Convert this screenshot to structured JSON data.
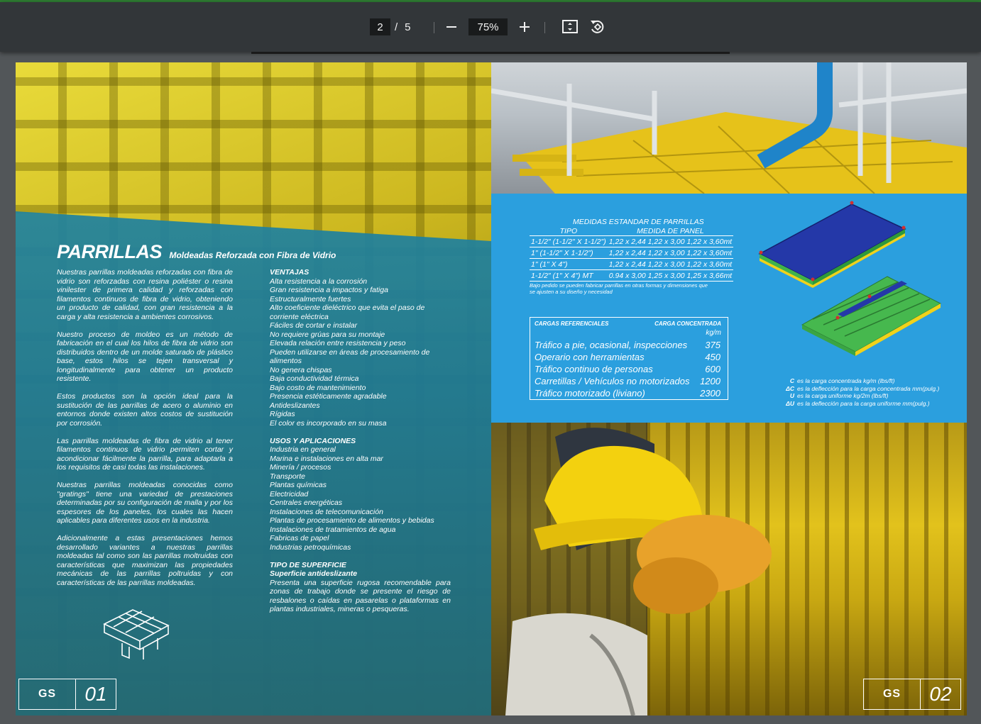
{
  "viewer": {
    "current_page": "2",
    "page_separator": "/",
    "total_pages": "5",
    "zoom": "75%",
    "zoom_out_icon": "minus-icon",
    "zoom_in_icon": "plus-icon",
    "fit_icon": "fit-page-icon",
    "rotate_icon": "rotate-icon"
  },
  "left_page": {
    "title": "PARRILLAS",
    "subtitle": "Moldeadas Reforzada con Fibra de Vidrio",
    "paragraphs": [
      "Nuestras parrillas moldeadas reforzadas con fibra de vidrio son reforzadas con resina poliéster o resina vinilester de primera calidad y reforzadas con filamentos continuos de fibra de vidrio, obteniendo un producto de calidad, con gran resistencia a la carga y alta resistencia a ambientes corrosivos.",
      "Nuestro proceso de moldeo es un método de fabricación en el cual los hilos de fibra de vidrio son distribuidos dentro de un molde saturado de plástico base, estos hilos se tejen transversal y longitudinalmente para obtener un producto resistente.",
      "Estos productos son la opción ideal para la sustitución de las parrillas de acero o aluminio en entornos donde existen altos costos de sustitución por corrosión.",
      "Las parrillas moldeadas de fibra de vidrio al tener filamentos continuos de vidrio permiten cortar y acondicionar fácilmente la parrilla, para adaptarla a los requisitos de casi todas las instalaciones.",
      "Nuestras parrillas moldeadas conocidas como \"gratings\" tiene una variedad de prestaciones determinadas por su configuración de malla y por los espesores de los paneles, los cuales las hacen aplicables para diferentes usos en la industria.",
      "Adicionalmente a estas presentaciones hemos desarrollado variantes a nuestras parrillas moldeadas tal como son las parrillas moltruidas con características que maximizan las propiedades mecánicas de las parrillas poltruidas y con características de las parrillas moldeadas."
    ],
    "ventajas_title": "VENTAJAS",
    "ventajas": [
      "Alta resistencia a la corrosión",
      "Gran resistencia a impactos y fatiga",
      "Estructuralmente fuertes",
      "Alto coeficiente dieléctrico que evita el paso de corriente eléctrica",
      "Fáciles de cortar e instalar",
      "No requiere grúas para su montaje",
      "Elevada relación entre resistencia y peso",
      "Pueden utilizarse en áreas de procesamiento de alimentos",
      "No genera chispas",
      "Baja conductividad térmica",
      "Bajo costo de mantenimiento",
      "Presencia estéticamente agradable",
      "Antideslizantes",
      "Rígidas",
      "El color es incorporado en su masa"
    ],
    "usos_title": "USOS Y APLICACIONES",
    "usos": [
      "Industria en general",
      "Marina e instalaciones en alta mar",
      "Minería / procesos",
      "Transporte",
      "Plantas químicas",
      "Electricidad",
      "Centrales energéticas",
      "Instalaciones de telecomunicación",
      "Plantas de procesamiento de alimentos y bebidas",
      "Instalaciones de tratamientos de agua",
      "Fabricas de papel",
      "Industrias petroquímicas"
    ],
    "superficie_title": "TIPO DE SUPERFICIE",
    "superficie_sub": "Superficie antideslizante",
    "superficie_desc": "Presenta una superficie rugosa recomendable para zonas de trabajo donde se presente el riesgo de resbalones o caídas en pasarelas o plataformas en plantas industriales, mineras o pesqueras.",
    "logo_text": "GS",
    "page_number": "01"
  },
  "right_page": {
    "std_title": "MEDIDAS ESTANDAR DE PARRILLAS",
    "std_headers": [
      "TIPO",
      "MEDIDA DE PANEL"
    ],
    "std_rows": [
      [
        "1-1/2\" (1-1/2\" X 1-1/2\")",
        "1,22 x 2,44 1,22 x 3,00 1,22 x 3,60mt"
      ],
      [
        "1\" (1-1/2\" X 1-1/2\")",
        "1,22 x 2,44 1,22 x 3,00 1,22 x 3,60mt"
      ],
      [
        "1\" (1\" X 4\")",
        "1,22 x 2,44 1,22 x 3,00 1,22 x 3,60mt"
      ],
      [
        "1-1/2\" (1\" X 4\") MT",
        "0.94 x 3,00 1,25 x 3,00 1,25 x 3,66mt"
      ]
    ],
    "std_note": "Bajo pedido se pueden fabricar parrillas en otras formas y dimensiones que se ajusten a su diseño y necesidad",
    "load_header_left": "CARGAS REFERENCIALES",
    "load_header_right": "CARGA CONCENTRADA",
    "load_unit": "kg/m",
    "load_rows": [
      [
        "Tráfico a pie, ocasional, inspecciones",
        "375"
      ],
      [
        "Operario con herramientas",
        "450"
      ],
      [
        "Tráfico continuo de personas",
        "600"
      ],
      [
        "Carretillas / Vehículos no motorizados",
        "1200"
      ],
      [
        "Tráfico motorizado (liviano)",
        "2300"
      ]
    ],
    "legend": [
      [
        "C",
        "es la carga concentrada kg/m (lbs/ft)"
      ],
      [
        "ΔC",
        "es la deflección para la carga concentrada mm(pulg.)"
      ],
      [
        "U",
        "es la carga uniforme kg/2m (lbs/ft)"
      ],
      [
        "ΔU",
        "es la deflección para la carga uniforme mm(pulg.)"
      ]
    ],
    "logo_text": "GS",
    "page_number": "02"
  }
}
